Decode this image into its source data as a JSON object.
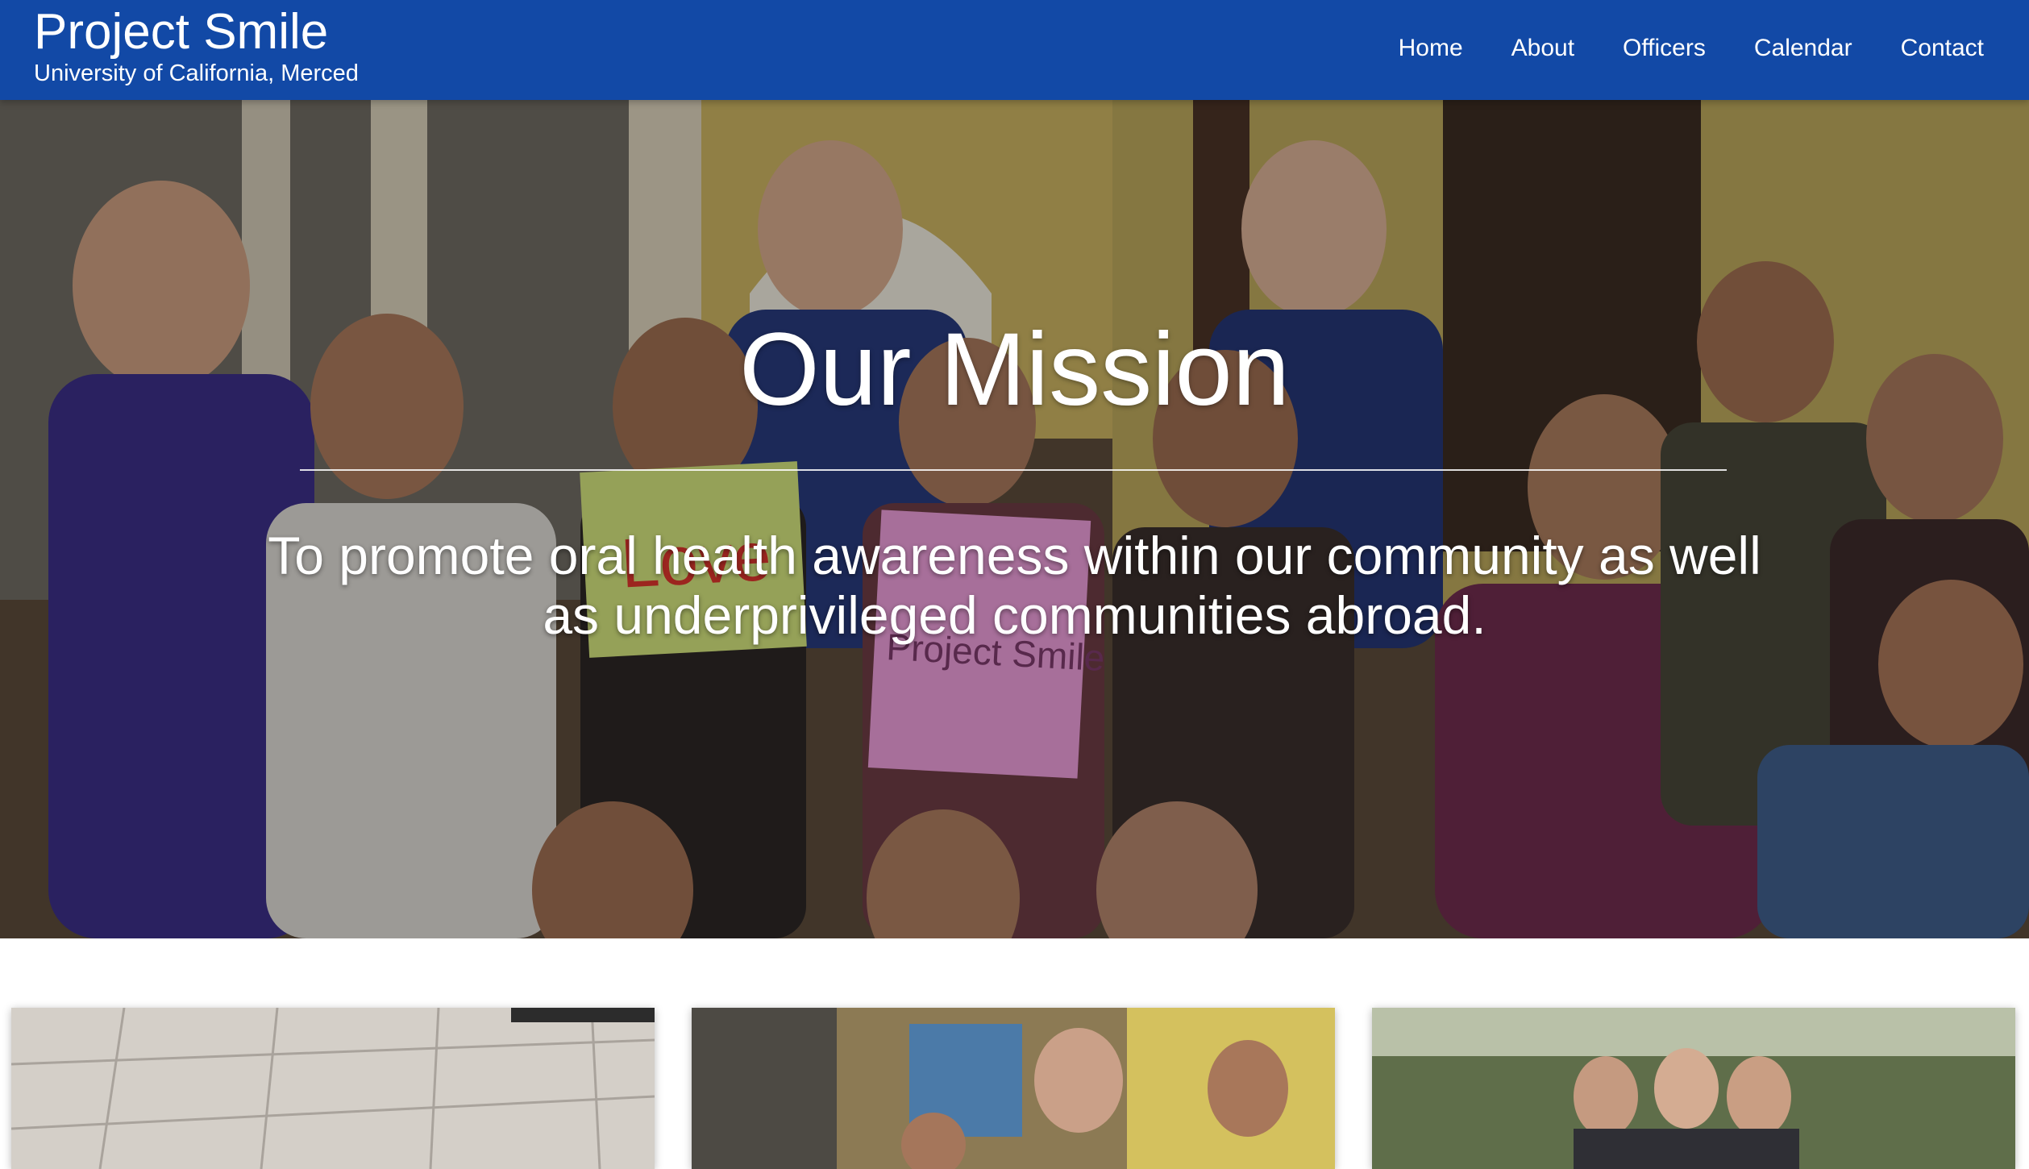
{
  "header": {
    "brand_title": "Project Smile",
    "brand_subtitle": "University of California, Merced",
    "nav": [
      {
        "label": "Home"
      },
      {
        "label": "About"
      },
      {
        "label": "Officers"
      },
      {
        "label": "Calendar"
      },
      {
        "label": "Contact"
      }
    ]
  },
  "hero": {
    "title": "Our Mission",
    "text": "To promote oral health awareness within our community as well as underprivileged communities abroad.",
    "sign_left": "Love",
    "sign_right": "Project Smile"
  },
  "colors": {
    "brand_blue": "#1249a6",
    "text_on_dark": "#ffffff"
  }
}
